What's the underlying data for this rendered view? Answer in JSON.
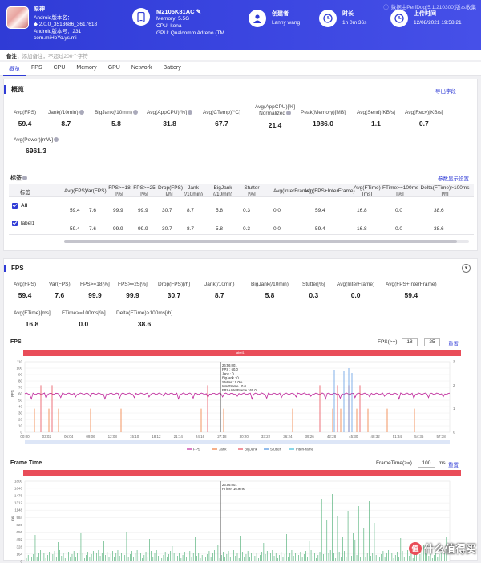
{
  "header": {
    "version_note": "数据由PerfDog(5.1.210300)版本收集",
    "app": {
      "name": "原神",
      "line1": "Android版本名：",
      "line2": "◆ 2.0.0_3513686_3617618",
      "line3": "Android版本号：231",
      "line4": "com.miHoYo.ys.mi"
    },
    "device": {
      "model": "M2105K81AC",
      "memory": "Memory: 5.5G",
      "cpu": "CPU: kona",
      "gpu": "GPU: Qualcomm Adreno (TM..."
    },
    "creator": {
      "label": "创建者",
      "value": "Lanny wang"
    },
    "duration": {
      "label": "时长",
      "value": "1h 0m 36s"
    },
    "upload": {
      "label": "上传时间",
      "value": "12/08/2021 19:58:21"
    }
  },
  "note": {
    "label": "备注：",
    "placeholder": "添加备注，不超过200个字符"
  },
  "tabs": [
    "概览",
    "FPS",
    "CPU",
    "Memory",
    "GPU",
    "Network",
    "Battery"
  ],
  "overview": {
    "title": "概览",
    "export_link": "导出字段",
    "metrics": [
      {
        "label": "Avg(FPS)",
        "value": "59.4"
      },
      {
        "label": "Jank(/10min)",
        "value": "8.7"
      },
      {
        "label": "BigJank(/10min)",
        "value": "5.8"
      },
      {
        "label": "Avg(AppCPU)[%]",
        "value": "31.8"
      },
      {
        "label": "Avg(CTemp)[°C]",
        "value": "67.7"
      },
      {
        "label": "Avg(AppCPU)[%] Normalized",
        "value": "21.4"
      },
      {
        "label": "Peak(Memory)[MB]",
        "value": "1986.0"
      },
      {
        "label": "Avg(Send)[KB/s]",
        "value": "1.1"
      },
      {
        "label": "Avg(Recv)[KB/s]",
        "value": "0.7"
      },
      {
        "label": "Avg(Power)[mW]",
        "value": "6961.3"
      }
    ],
    "labels_title": "标签",
    "labels_link": "参数显示设置",
    "table_headers": [
      "标签",
      "Avg(FPS)",
      "Var(FPS)",
      "FPS>=18 [%]",
      "FPS>=25 [%]",
      "Drop(FPS) [/h]",
      "Jank (/10min)",
      "BigJank (/10min)",
      "Stutter [%]",
      "Avg(InterFrame)",
      "Avg(FPS+InterFrame)",
      "Avg(FTime) [ms]",
      "FTime>=100ms [%]",
      "Delta(FTime)>100ms [/h]"
    ],
    "table_rows": [
      {
        "label": "All",
        "cells": [
          "59.4",
          "7.6",
          "99.9",
          "99.9",
          "30.7",
          "8.7",
          "5.8",
          "0.3",
          "0.0",
          "59.4",
          "16.8",
          "0.0",
          "38.6"
        ]
      },
      {
        "label": "label1",
        "cells": [
          "59.4",
          "7.6",
          "99.9",
          "99.9",
          "30.7",
          "8.7",
          "5.8",
          "0.3",
          "0.0",
          "59.4",
          "16.8",
          "0.0",
          "38.6"
        ]
      }
    ]
  },
  "fps_section": {
    "title": "FPS",
    "metrics": [
      {
        "label": "Avg(FPS)",
        "value": "59.4"
      },
      {
        "label": "Var(FPS)",
        "value": "7.6"
      },
      {
        "label": "FPS>=18[%]",
        "value": "99.9"
      },
      {
        "label": "FPS>=25[%]",
        "value": "99.9"
      },
      {
        "label": "Drop(FPS)[/h]",
        "value": "30.7"
      },
      {
        "label": "Jank(/10min)",
        "value": "8.7"
      },
      {
        "label": "BigJank(/10min)",
        "value": "5.8"
      },
      {
        "label": "Stutter[%]",
        "value": "0.3"
      },
      {
        "label": "Avg(InterFrame)",
        "value": "0.0"
      },
      {
        "label": "Avg(FPS+InterFrame)",
        "value": "59.4"
      },
      {
        "label": "Avg(FTime)[ms]",
        "value": "16.8"
      },
      {
        "label": "FTime>=100ms[%]",
        "value": "0.0"
      },
      {
        "label": "Delta(FTime)>100ms[/h]",
        "value": "38.6"
      }
    ],
    "chart_label": "FPS",
    "fps_filter_label": "FPS(>=)",
    "fps_filter_a": "18",
    "fps_filter_b": "25",
    "reset": "重置",
    "bar_label": "label1",
    "tooltip": [
      "26:56:001",
      "FPS : 60.0",
      "Jank : 0",
      "BigJank : 0",
      "Stutter : 0.0%",
      "InterFrame : 0.0",
      "FPS+InterFrame : 60.0"
    ],
    "legend": [
      "FPS",
      "Jank",
      "BigJank",
      "Stutter",
      "InterFrame"
    ],
    "legend_colors": [
      "#c0279c",
      "#f07a3a",
      "#e94d59",
      "#4a8ee0",
      "#3bbcd8"
    ],
    "frametime_title": "Frame Time",
    "frametime_filter_label": "FrameTime(>=)",
    "frametime_filter_value": "100",
    "frametime_unit": "ms",
    "frametime_reset": "重置",
    "frametime_tooltip": [
      "26:56:001",
      "FTime: 16.9ms"
    ]
  },
  "chart_data": [
    {
      "type": "line",
      "title": "FPS",
      "ylabel": "FPS",
      "ylim": [
        0,
        110
      ],
      "yticks": [
        0,
        10,
        20,
        30,
        40,
        50,
        60,
        70,
        80,
        90,
        100,
        110
      ],
      "y2ticks": [
        0,
        1,
        2,
        3
      ],
      "x_ticks": [
        "00:00",
        "03:02",
        "06:04",
        "09:06",
        "12:08",
        "15:10",
        "18:12",
        "21:14",
        "24:16",
        "27:18",
        "30:20",
        "33:22",
        "36:24",
        "39:26",
        "42:28",
        "45:30",
        "48:32",
        "51:34",
        "54:36",
        "57:38"
      ],
      "series": [
        {
          "name": "FPS",
          "baseline": 60
        },
        {
          "name": "Jank"
        },
        {
          "name": "BigJank"
        },
        {
          "name": "Stutter"
        },
        {
          "name": "InterFrame"
        }
      ]
    },
    {
      "type": "line",
      "title": "Frame Time",
      "ylabel": "ms",
      "yticks": [
        0,
        164,
        328,
        492,
        656,
        820,
        984,
        1148,
        1312,
        1476,
        1640,
        1800
      ]
    }
  ],
  "watermark": "什么值得买"
}
